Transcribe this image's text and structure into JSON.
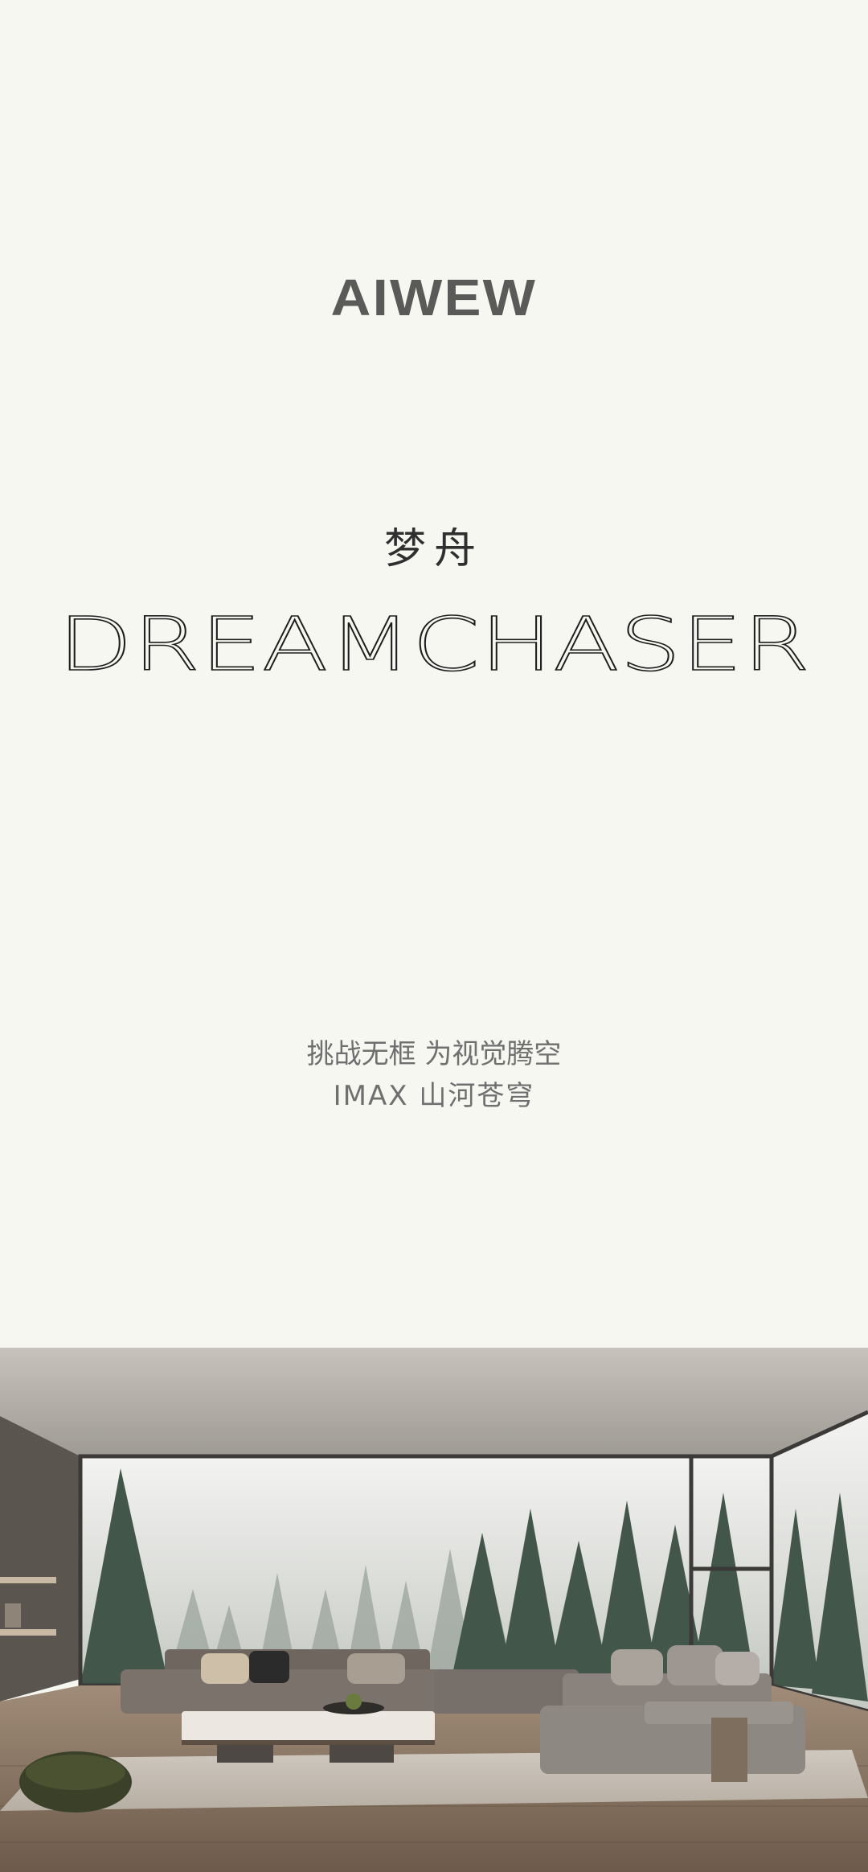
{
  "brand": {
    "logo_text": "AIWEW"
  },
  "product": {
    "name_cn": "梦舟",
    "name_en": "DREAMCHASER"
  },
  "slogan": {
    "line1": "挑战无框 为视觉腾空",
    "line2": "IMAX 山河苍穹"
  },
  "colors": {
    "background": "#f7f7f2",
    "logo": "#5a5a58",
    "text_dark": "#2f2f2f",
    "text_gray": "#6f6f6f"
  }
}
